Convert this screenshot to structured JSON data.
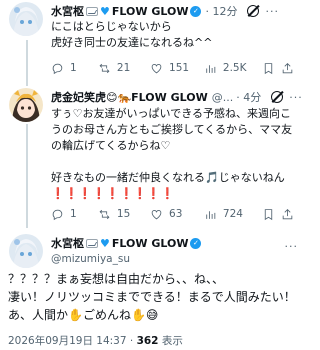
{
  "posts": [
    {
      "name": "水宮枢",
      "flow": "FLOW GLOW",
      "time": "· 12分",
      "text": "にこはとらじゃないから\n虎好き同士の友達になれるね^^",
      "counts": {
        "replies": "1",
        "reposts": "21",
        "likes": "151",
        "views": "2.5K"
      }
    },
    {
      "name": "虎金妃笑虎😊🐅FLOW GLOW",
      "handle": "@...",
      "time": "· 4分",
      "text": "すぅ♡お友達がいっぱいできる予感ね、来週向こうのお母さん方ともご挨拶してくるから、ママ友の輪広げてくるからね♡\n\n好きなもの一緒だ仲良くなれる🎵じゃないねん\n❗❗❗❗❗❗❗❗❗",
      "counts": {
        "replies": "1",
        "reposts": "15",
        "likes": "63",
        "views": "724"
      }
    }
  ],
  "main": {
    "name": "水宮枢",
    "flow": "FLOW GLOW",
    "handle": "@mizumiya_su",
    "text": "？？？？まぁ妄想は自由だから、、ね、、\n凄い！ノリツッコミまでできる！まるで人間みたい！\nあ、人間か✋ごめんね✋😅",
    "date": "2026年09月19日 14:37 · ",
    "views_count": "362",
    "views_label": " 表示"
  },
  "icons": {
    "reply": "reply-icon",
    "repost": "repost-icon",
    "like": "heart-icon",
    "views": "views-icon",
    "bookmark": "bookmark-icon",
    "share": "share-icon",
    "grok": "grok-icon"
  },
  "colors": {
    "accent": "#1d9bf0",
    "muted": "#536471",
    "text": "#0f1419"
  }
}
